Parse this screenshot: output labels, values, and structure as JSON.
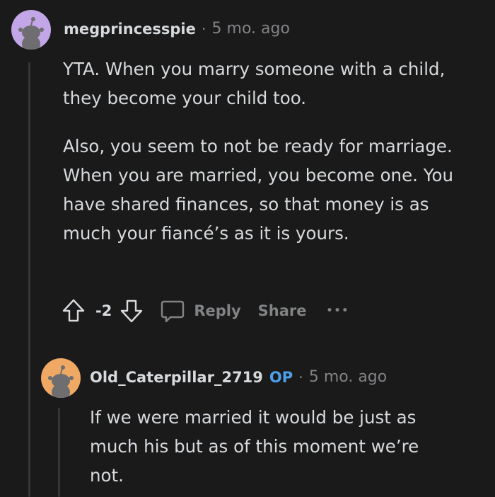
{
  "comments": [
    {
      "username": "megprincesspie",
      "separator": "·",
      "time": "5 mo. ago",
      "avatar": "snoo-avatar-purple",
      "paragraphs": [
        "YTA. When you marry someone with a child, they become your child too.",
        "Also, you seem to not be ready for marriage. When you are married, you become one. You have shared finances, so that money is as much your fiancé’s as it is yours."
      ],
      "vote_count": "-2",
      "reply_label": "Reply",
      "share_label": "Share",
      "more_label": "•••"
    },
    {
      "username": "Old_Caterpillar_2719",
      "op_badge": "OP",
      "separator": "·",
      "time": "5 mo. ago",
      "avatar": "snoo-avatar-orange",
      "paragraphs": [
        "If we were married it would be just as much his but as of this moment we’re not."
      ]
    }
  ],
  "colors": {
    "background": "#1a1a1b",
    "text": "#d7dadc",
    "muted": "#818384",
    "op_blue": "#4c9fe8",
    "thread_line": "#343536",
    "avatar_purple": "#c3a6e8",
    "avatar_orange": "#f0a965"
  }
}
